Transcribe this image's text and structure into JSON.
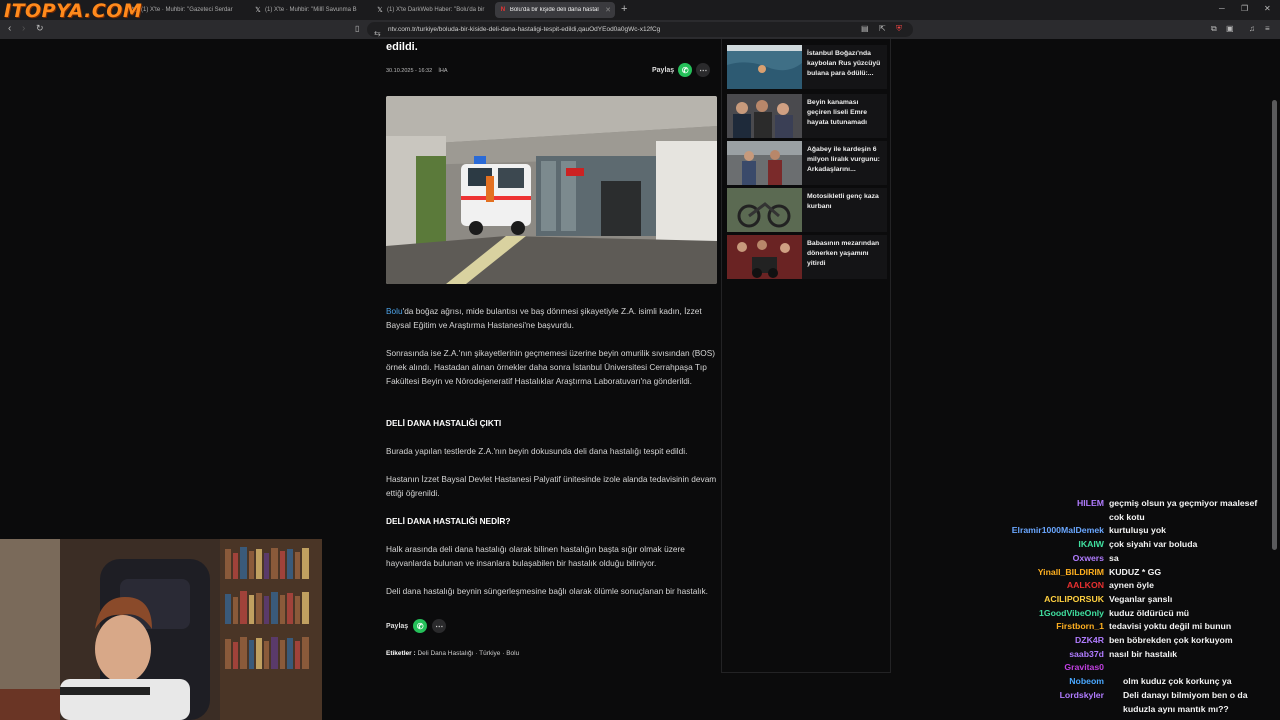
{
  "logo": "ITOPYA.COM",
  "tabs": [
    {
      "label": "(1) X'te · Muhbir: \"Gazeteci Serdar",
      "icon": "x-icon"
    },
    {
      "label": "(1) X'te · Muhbir: \"Millî Savunma B",
      "icon": "x-icon"
    },
    {
      "label": "(1) X'te DarkWeb Haber: \"Bolu'da bir",
      "icon": "x-icon"
    },
    {
      "label": "Bolu'da bir kişide deli dana hastal",
      "icon": "ntv-icon"
    }
  ],
  "url": "ntv.com.tr/turkiye/boluda-bir-kiside-deli-dana-hastaligi-tespit-edildi,qauOdYEod0a0gWc-x12fCg",
  "article": {
    "headline_tail": "edildi.",
    "date": "30.10.2025 - 16:32",
    "source": "İHA",
    "share_label": "Paylaş",
    "p1_link": "Bolu",
    "p1_rest": "'da boğaz ağrısı, mide bulantısı ve baş dönmesi şikayetiyle Z.A. isimli kadın, İzzet Baysal Eğitim ve Araştırma Hastanesi'ne başvurdu.",
    "p2": "Sonrasında ise Z.A.'nın şikayetlerinin geçmemesi üzerine beyin omurilik sıvısından (BOS) örnek alındı. Hastadan alınan örnekler daha sonra İstanbul Üniversitesi Cerrahpaşa Tıp Fakültesi Beyin ve Nörodejeneratif Hastalıklar Araştırma Laboratuvarı'na gönderildi.",
    "h1": "DELİ DANA HASTALIĞI ÇIKTI",
    "p3": "Burada yapılan testlerde Z.A.'nın beyin dokusunda deli dana hastalığı tespit edildi.",
    "p4": "Hastanın İzzet Baysal Devlet Hastanesi Palyatif ünitesinde izole alanda tedavisinin devam ettiği öğrenildi.",
    "h2": "DELİ DANA HASTALIĞI NEDİR?",
    "p5": "Halk arasında deli dana hastalığı olarak bilinen hastalığın başta sığır olmak üzere hayvanlarda bulunan ve insanlara bulaşabilen bir hastalık olduğu biliniyor.",
    "p6": "Deli dana hastalığı beynin süngerleşmesine bağlı olarak ölümle sonuçlanan bir hastalık.",
    "tags_label": "Etiketler :",
    "tags": [
      "Deli Dana Hastalığı",
      "Türkiye",
      "Bolu"
    ]
  },
  "sidebar": [
    {
      "title": "İstanbul Boğazı'nda kaybolan Rus yüzcüyü bulana para ödülü:..."
    },
    {
      "title": "Beyin kanaması geçiren liseli Emre hayata tutunamadı"
    },
    {
      "title": "Ağabey ile kardeşin 6 milyon liralık vurgunu: Arkadaşlarını..."
    },
    {
      "title": "Motosikletli genç kaza kurbanı"
    },
    {
      "title": "Babasının mezarından dönerken yaşamını yitirdi"
    }
  ],
  "chat": [
    {
      "user": "HILEM",
      "color": "#b07cff",
      "msg": "geçmiş olsun ya geçmiyor maalesef"
    },
    {
      "user": "",
      "color": "#ffffff",
      "msg": "cok kotu"
    },
    {
      "user": "Elramir1000MalDemek",
      "color": "#6aa7ff",
      "msg": "kurtuluşu yok"
    },
    {
      "user": "IKAIW",
      "color": "#40e0a0",
      "msg": "çok siyahi var boluda"
    },
    {
      "user": "Oxwers",
      "color": "#b07cff",
      "msg": "sa"
    },
    {
      "user": "Yinall_BILDIRIM",
      "color": "#ffb020",
      "msg": "KUDUZ * GG"
    },
    {
      "user": "AALKON",
      "color": "#e83030",
      "msg": "aynen öyle"
    },
    {
      "user": "ACILIPORSUK",
      "color": "#ffd040",
      "msg": "Veganlar şanslı"
    },
    {
      "user": "1GoodVibeOnly",
      "color": "#40e0a0",
      "msg": "kuduz öldürücü mü"
    },
    {
      "user": "Firstborn_1",
      "color": "#ffb020",
      "msg": "tedavisi yoktu değil mi bunun"
    },
    {
      "user": "DZK4R",
      "color": "#b07cff",
      "msg": "ben böbrekden çok korkuyom"
    },
    {
      "user": "saab37d",
      "color": "#b07cff",
      "msg": "nasıl bir hastalık"
    },
    {
      "user": "Gravitas0",
      "color": "#c040e0",
      "msg": ""
    },
    {
      "user": "Nobeom",
      "color": "#4aa8ff",
      "msg": "olm kuduz çok korkunç ya"
    },
    {
      "user": "Lordskyler",
      "color": "#b07cff",
      "msg": "Deli danayı bilmiyom ben o da"
    },
    {
      "user": "",
      "color": "#ffffff",
      "msg": "kuduzla aynı mantık mı??"
    }
  ]
}
